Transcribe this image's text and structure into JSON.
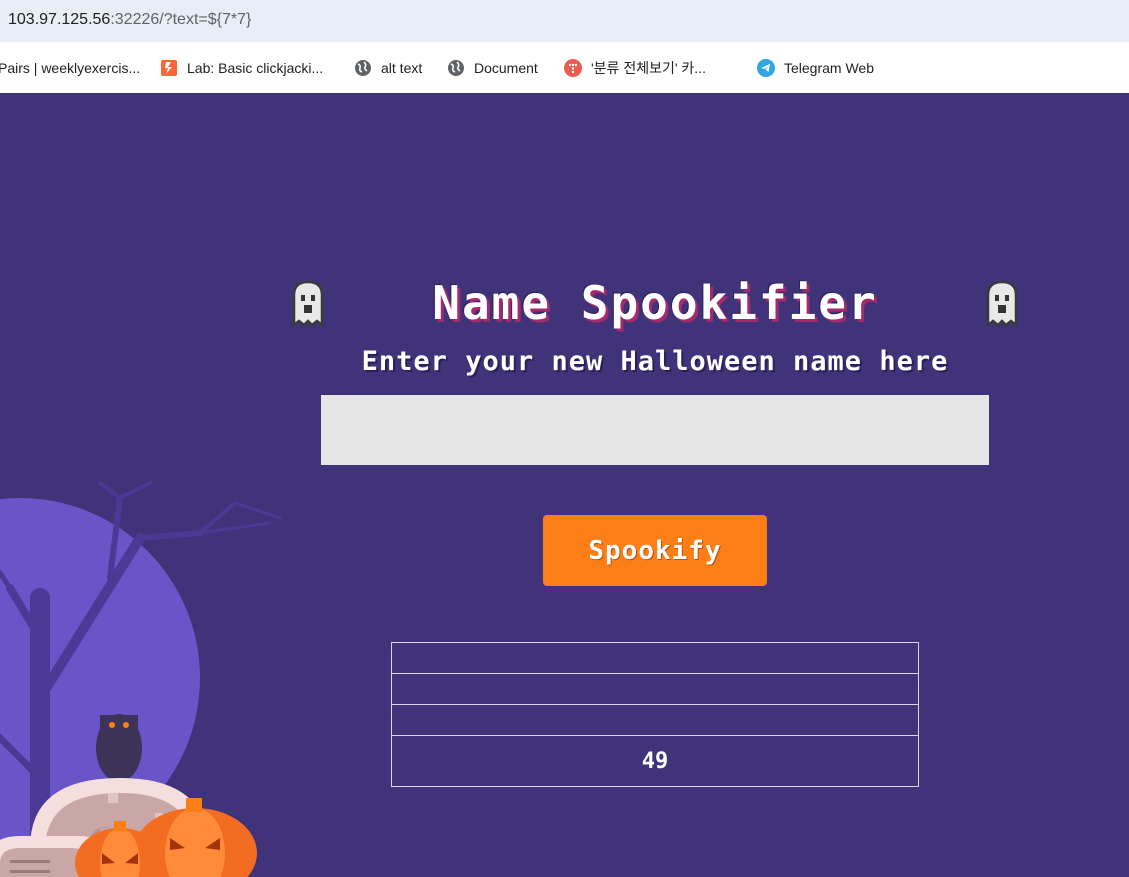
{
  "browser": {
    "url_host": "103.97.125.56",
    "url_rest": ":32226/?text=${7*7}"
  },
  "bookmarks": [
    {
      "label": "Pairs | weeklyexercis...",
      "icon": "page-icon"
    },
    {
      "label": "Lab: Basic clickjacki...",
      "icon": "lab-flag-icon"
    },
    {
      "label": "alt text",
      "icon": "globe-icon"
    },
    {
      "label": "Document",
      "icon": "globe-icon"
    },
    {
      "label": "'분류 전체보기' 카...",
      "icon": "blog-icon"
    },
    {
      "label": "Telegram Web",
      "icon": "telegram-icon"
    }
  ],
  "app": {
    "title": "Name Spookifier",
    "subtitle": "Enter your new Halloween name here",
    "input_value": "",
    "button_label": "Spookify",
    "results": [
      "",
      "",
      "",
      "49"
    ]
  },
  "colors": {
    "background": "#41337a",
    "button": "#fd7e14",
    "input": "#e5e5e5"
  }
}
